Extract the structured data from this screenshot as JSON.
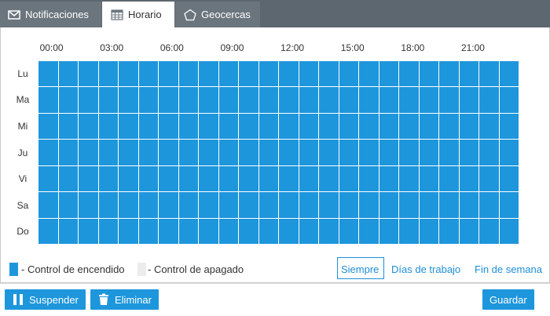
{
  "tabs": {
    "notifications": "Notificaciones",
    "schedule": "Horario",
    "geofences": "Geocercas"
  },
  "hour_labels": [
    "00:00",
    "03:00",
    "06:00",
    "09:00",
    "12:00",
    "15:00",
    "18:00",
    "21:00"
  ],
  "days": [
    "Lu",
    "Ma",
    "Mi",
    "Ju",
    "Vi",
    "Sa",
    "Do"
  ],
  "schedule_grid": {
    "columns": 24,
    "rows": 7,
    "active_fraction": 1.0
  },
  "legend": {
    "on_text": "- Control de encendido",
    "off_text": "- Control de apagado"
  },
  "presets": {
    "always": "Siempre",
    "workdays": "Días de trabajo",
    "weekend": "Fin de semana",
    "selected": "Siempre"
  },
  "buttons": {
    "suspend": "Suspender",
    "delete": "Eliminar",
    "save": "Guardar"
  },
  "colors": {
    "accent": "#1e96dc",
    "tab_bar": "#5d6770",
    "cell_off": "#e6e6e6"
  }
}
